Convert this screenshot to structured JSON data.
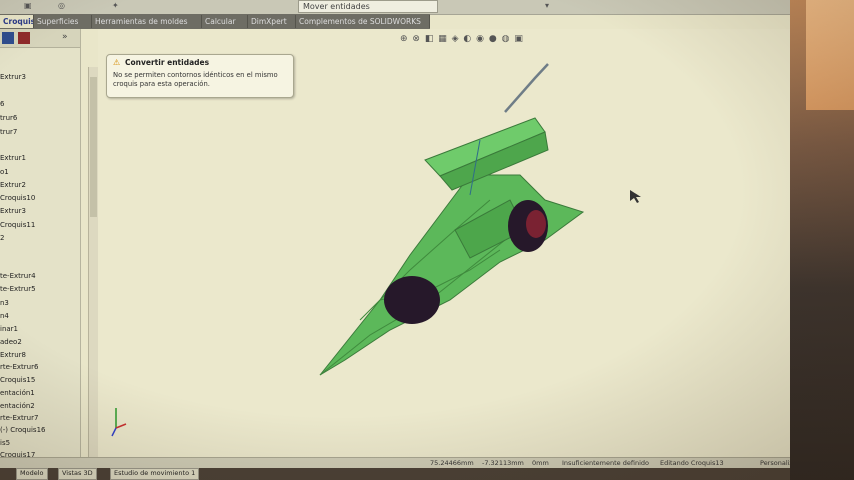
{
  "window": {
    "title": "Mover entidades"
  },
  "tabs": [
    {
      "label": "Croquis",
      "active": true
    },
    {
      "label": "Superficies",
      "active": false
    },
    {
      "label": "Herramientas de moldes",
      "active": false
    },
    {
      "label": "Calcular",
      "active": false
    },
    {
      "label": "DimXpert",
      "active": false
    },
    {
      "label": "Complementos de SOLIDWORKS",
      "active": false
    }
  ],
  "tree": {
    "items": [
      "Extrur3",
      "6",
      "trur6",
      "trur7",
      "Extrur1",
      "o1",
      "Extrur2",
      "Croquis10",
      "Extrur3",
      "Croquis11",
      "2",
      "te-Extrur4",
      "te-Extrur5",
      "n3",
      "n4",
      "inar1",
      "adeo2",
      "Extrur8",
      "rte-Extrur6",
      "Croquis15",
      "entación1",
      "entación2",
      "rte-Extrur7",
      "(-) Croquis16",
      "is5",
      "Croquis17"
    ]
  },
  "tooltip": {
    "title": "Convertir entidades",
    "message": "No se permiten contornos idénticos en el mismo croquis para esta operación."
  },
  "status": {
    "x": "75.24466mm",
    "y": "-7.32113mm",
    "z": "0mm",
    "state": "Insuficientemente definido",
    "mode": "Editando Croquis13",
    "units": "Personalizado"
  },
  "bottom_tabs": [
    "Modelo",
    "Vistas 3D",
    "Estudio de movimiento 1"
  ],
  "colors": {
    "model_green": "#5cb85a",
    "wheel": "#26182a",
    "background": "#ebe8cc",
    "accent": "#2b3a8a"
  }
}
